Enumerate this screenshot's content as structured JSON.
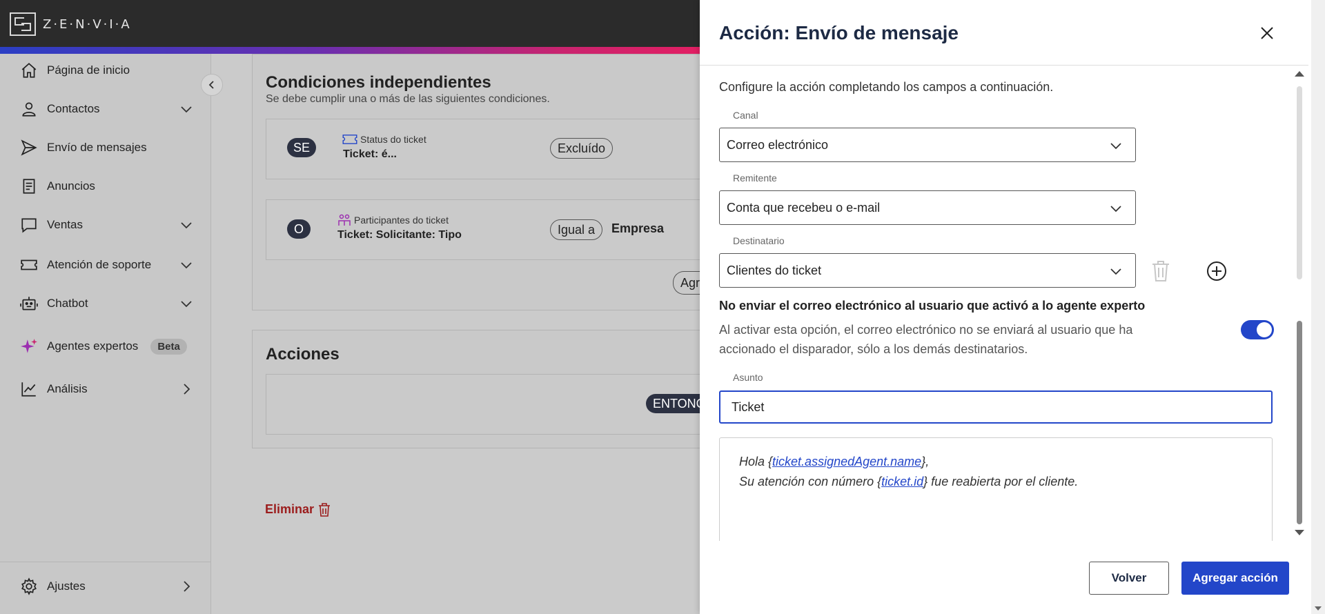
{
  "brand": {
    "name": "Z·E·N·V·I·A"
  },
  "sidebar": {
    "items": [
      {
        "label": "Página de inicio",
        "icon": "home-icon"
      },
      {
        "label": "Contactos",
        "icon": "person-icon"
      },
      {
        "label": "Envío de mensajes",
        "icon": "send-icon"
      },
      {
        "label": "Anuncios",
        "icon": "document-icon"
      },
      {
        "label": "Ventas",
        "icon": "chat-icon"
      },
      {
        "label": "Atención de soporte",
        "icon": "ticket-icon"
      },
      {
        "label": "Chatbot",
        "icon": "robot-icon"
      },
      {
        "label": "Agentes expertos",
        "icon": "sparkle-icon",
        "badge": "Beta"
      },
      {
        "label": "Análisis",
        "icon": "chart-icon"
      }
    ],
    "settings_label": "Ajustes"
  },
  "main": {
    "conditions": {
      "title": "Condiciones independientes",
      "subtitle": "Se debe cumplir una o más de las siguientes condiciones.",
      "rows": [
        {
          "prefix": "SE",
          "field_label": "Status do ticket",
          "field_value": "Ticket: é...",
          "operator": "Excluído",
          "value": ""
        },
        {
          "prefix": "O",
          "field_label": "Participantes do ticket",
          "field_value": "Ticket: Solicitante: Tipo",
          "operator": "Igual a",
          "value": "Empresa"
        }
      ],
      "add_partial": "Agr"
    },
    "actions": {
      "title": "Acciones",
      "then_partial": "ENTONC"
    },
    "delete_label": "Eliminar"
  },
  "panel": {
    "title": "Acción: Envío de mensaje",
    "intro": "Configure la acción completando los campos a continuación.",
    "channel": {
      "label": "Canal",
      "value": "Correo electrónico"
    },
    "sender": {
      "label": "Remitente",
      "value": "Conta que recebeu o e-mail"
    },
    "recipient": {
      "label": "Destinatario",
      "value": "Clientes do ticket"
    },
    "toggle": {
      "title": "No enviar el correo electrónico al usuario que activó a lo agente experto",
      "description": "Al activar esta opción, el correo electrónico no se enviará al usuario que ha accionado el disparador, sólo a los demás destinatarios.",
      "enabled": true
    },
    "subject": {
      "label": "Asunto",
      "value": "Ticket"
    },
    "body": {
      "line1_pre": "Hola {",
      "line1_link": "ticket.assignedAgent.name",
      "line1_post": "},",
      "line2_pre": "Su atención con número {",
      "line2_link": "ticket.id",
      "line2_post": "} fue reabierta por el cliente."
    },
    "buttons": {
      "back": "Volver",
      "add": "Agregar acción"
    }
  },
  "colors": {
    "primary": "#2346c9",
    "danger": "#9b1c1c",
    "topbar": "#2b2b2b"
  }
}
